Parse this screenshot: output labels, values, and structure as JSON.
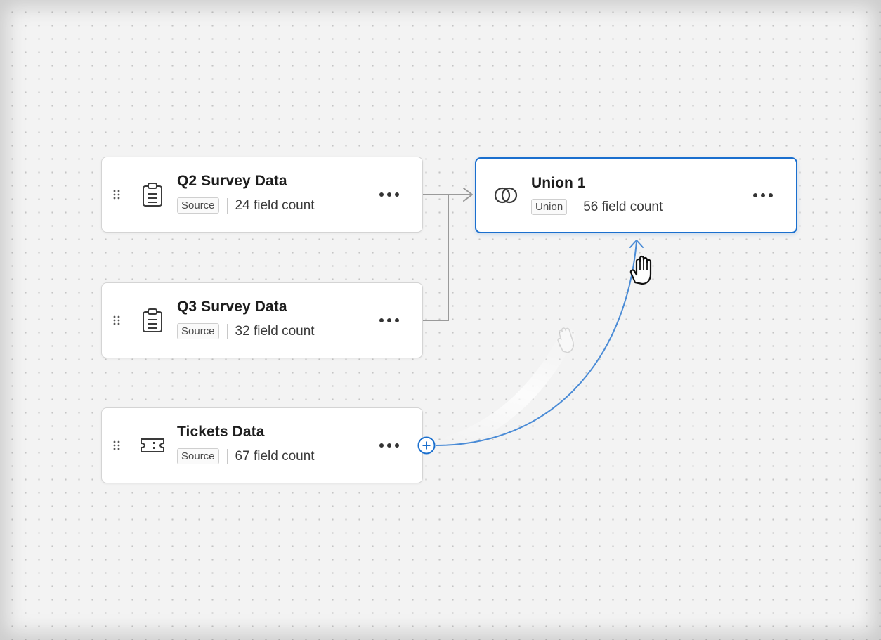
{
  "nodes": [
    {
      "title": "Q2 Survey Data",
      "badge": "Source",
      "count": "24 field count",
      "icon": "clipboard-icon"
    },
    {
      "title": "Q3 Survey Data",
      "badge": "Source",
      "count": "32 field count",
      "icon": "clipboard-icon"
    },
    {
      "title": "Tickets Data",
      "badge": "Source",
      "count": "67 field count",
      "icon": "ticket-icon"
    }
  ],
  "union": {
    "title": "Union 1",
    "badge": "Union",
    "count": "56 field count",
    "icon": "union-icon"
  },
  "icons": {
    "drag": "drag-handle-icon",
    "more": "more-horizontal-icon",
    "add_port": "plus-circle-icon",
    "cursor": "grab-hand-cursor"
  },
  "colors": {
    "accent": "#1a6fce",
    "connector": "#9a9a9a",
    "drag_line": "#4a8bd6",
    "node_border": "#d4d4d4"
  }
}
